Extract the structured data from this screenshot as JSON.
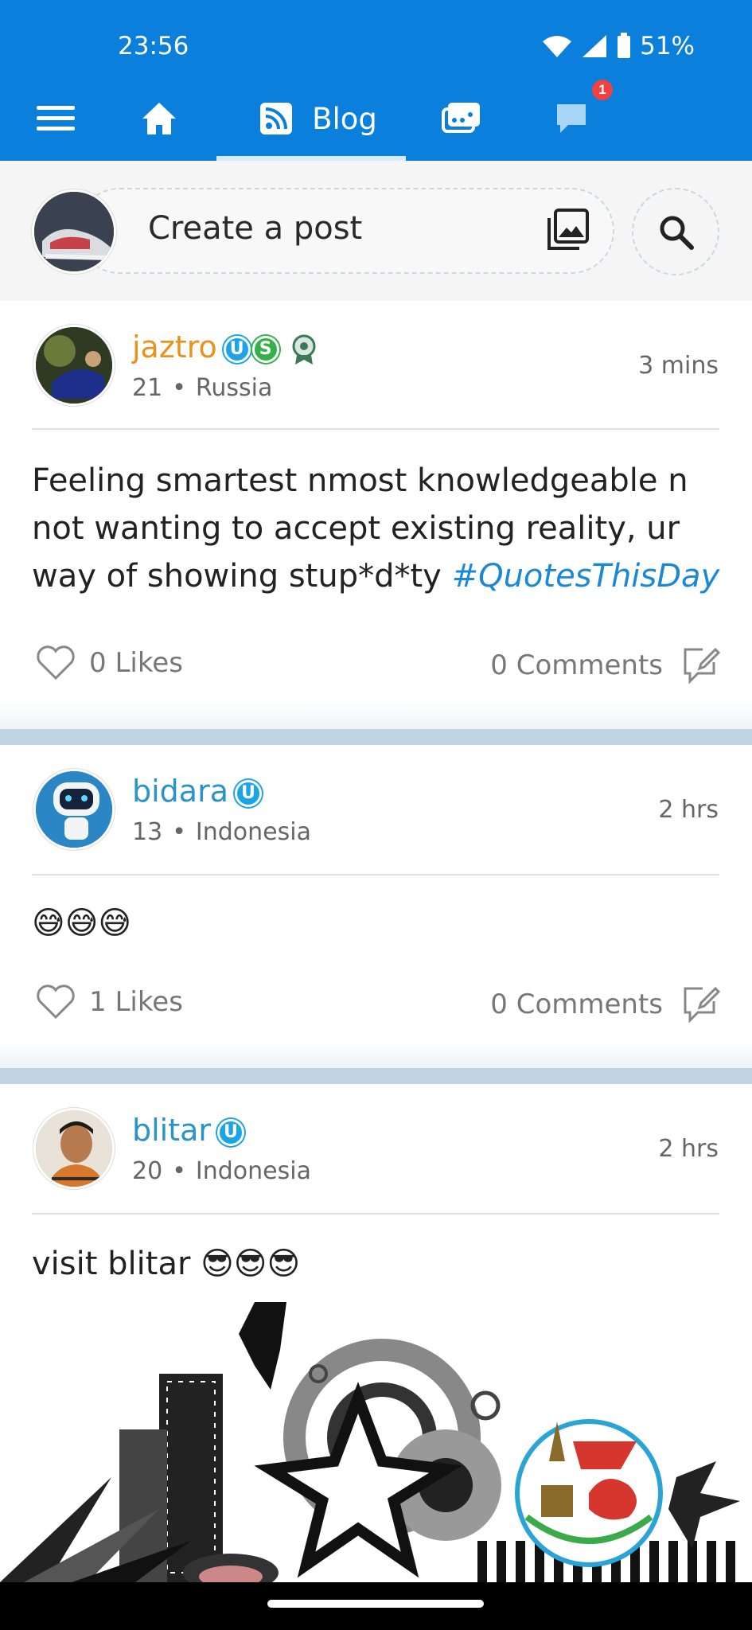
{
  "status_bar": {
    "time": "23:56",
    "battery": "51%"
  },
  "nav": {
    "active_tab_label": "Blog",
    "notification_count": "1",
    "icons": [
      "menu-icon",
      "home-icon",
      "rss-icon",
      "messages-icon",
      "chat-icon"
    ]
  },
  "composer": {
    "placeholder": "Create a post"
  },
  "colors": {
    "primary": "#0a7fdc",
    "hashtag": "#1a88d6",
    "username_gold": "#e8931c",
    "username_blue": "#2a93c9"
  },
  "posts": [
    {
      "username": "jaztro",
      "age": "21",
      "country": "Russia",
      "time": "3 mins",
      "text": "Feeling smartest nmost knowledgeable n not wanting to accept existing reality, ur way of showing stup*d*ty ",
      "hashtag": "#QuotesThisDay",
      "likes": "0 Likes",
      "comments": "0 Comments",
      "badges": [
        "U",
        "S"
      ]
    },
    {
      "username": "bidara",
      "age": "13",
      "country": "Indonesia",
      "time": "2 hrs",
      "text": "😅😅😅",
      "likes": "1 Likes",
      "comments": "0 Comments",
      "badges": [
        "U"
      ]
    },
    {
      "username": "blitar",
      "age": "20",
      "country": "Indonesia",
      "time": "2 hrs",
      "text": "visit blitar 😎😎😎",
      "badges": [
        "U"
      ]
    }
  ]
}
